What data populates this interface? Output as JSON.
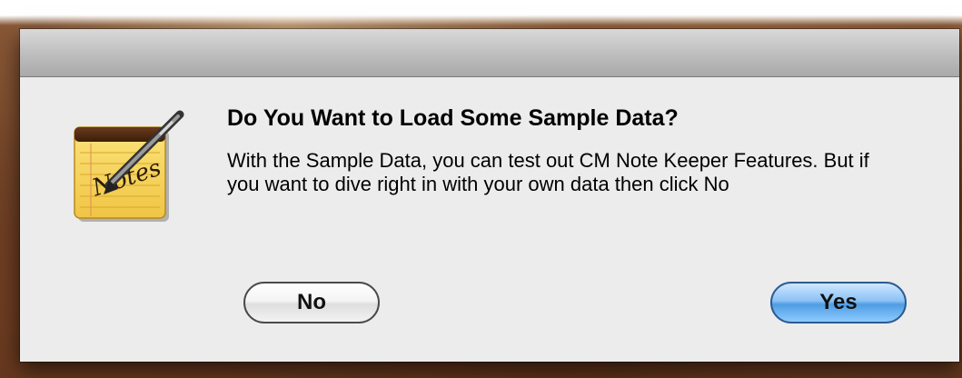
{
  "dialog": {
    "title": "Do You Want to Load Some Sample Data?",
    "message": "With the Sample Data, you can test out CM Note Keeper Features. But if you want to dive right in with your own data then click No",
    "icon": "notes-app-icon",
    "icon_text": "Notes"
  },
  "buttons": {
    "no_label": "No",
    "yes_label": "Yes"
  },
  "colors": {
    "dialog_bg": "#ececec",
    "default_button": "#4f9de3"
  }
}
